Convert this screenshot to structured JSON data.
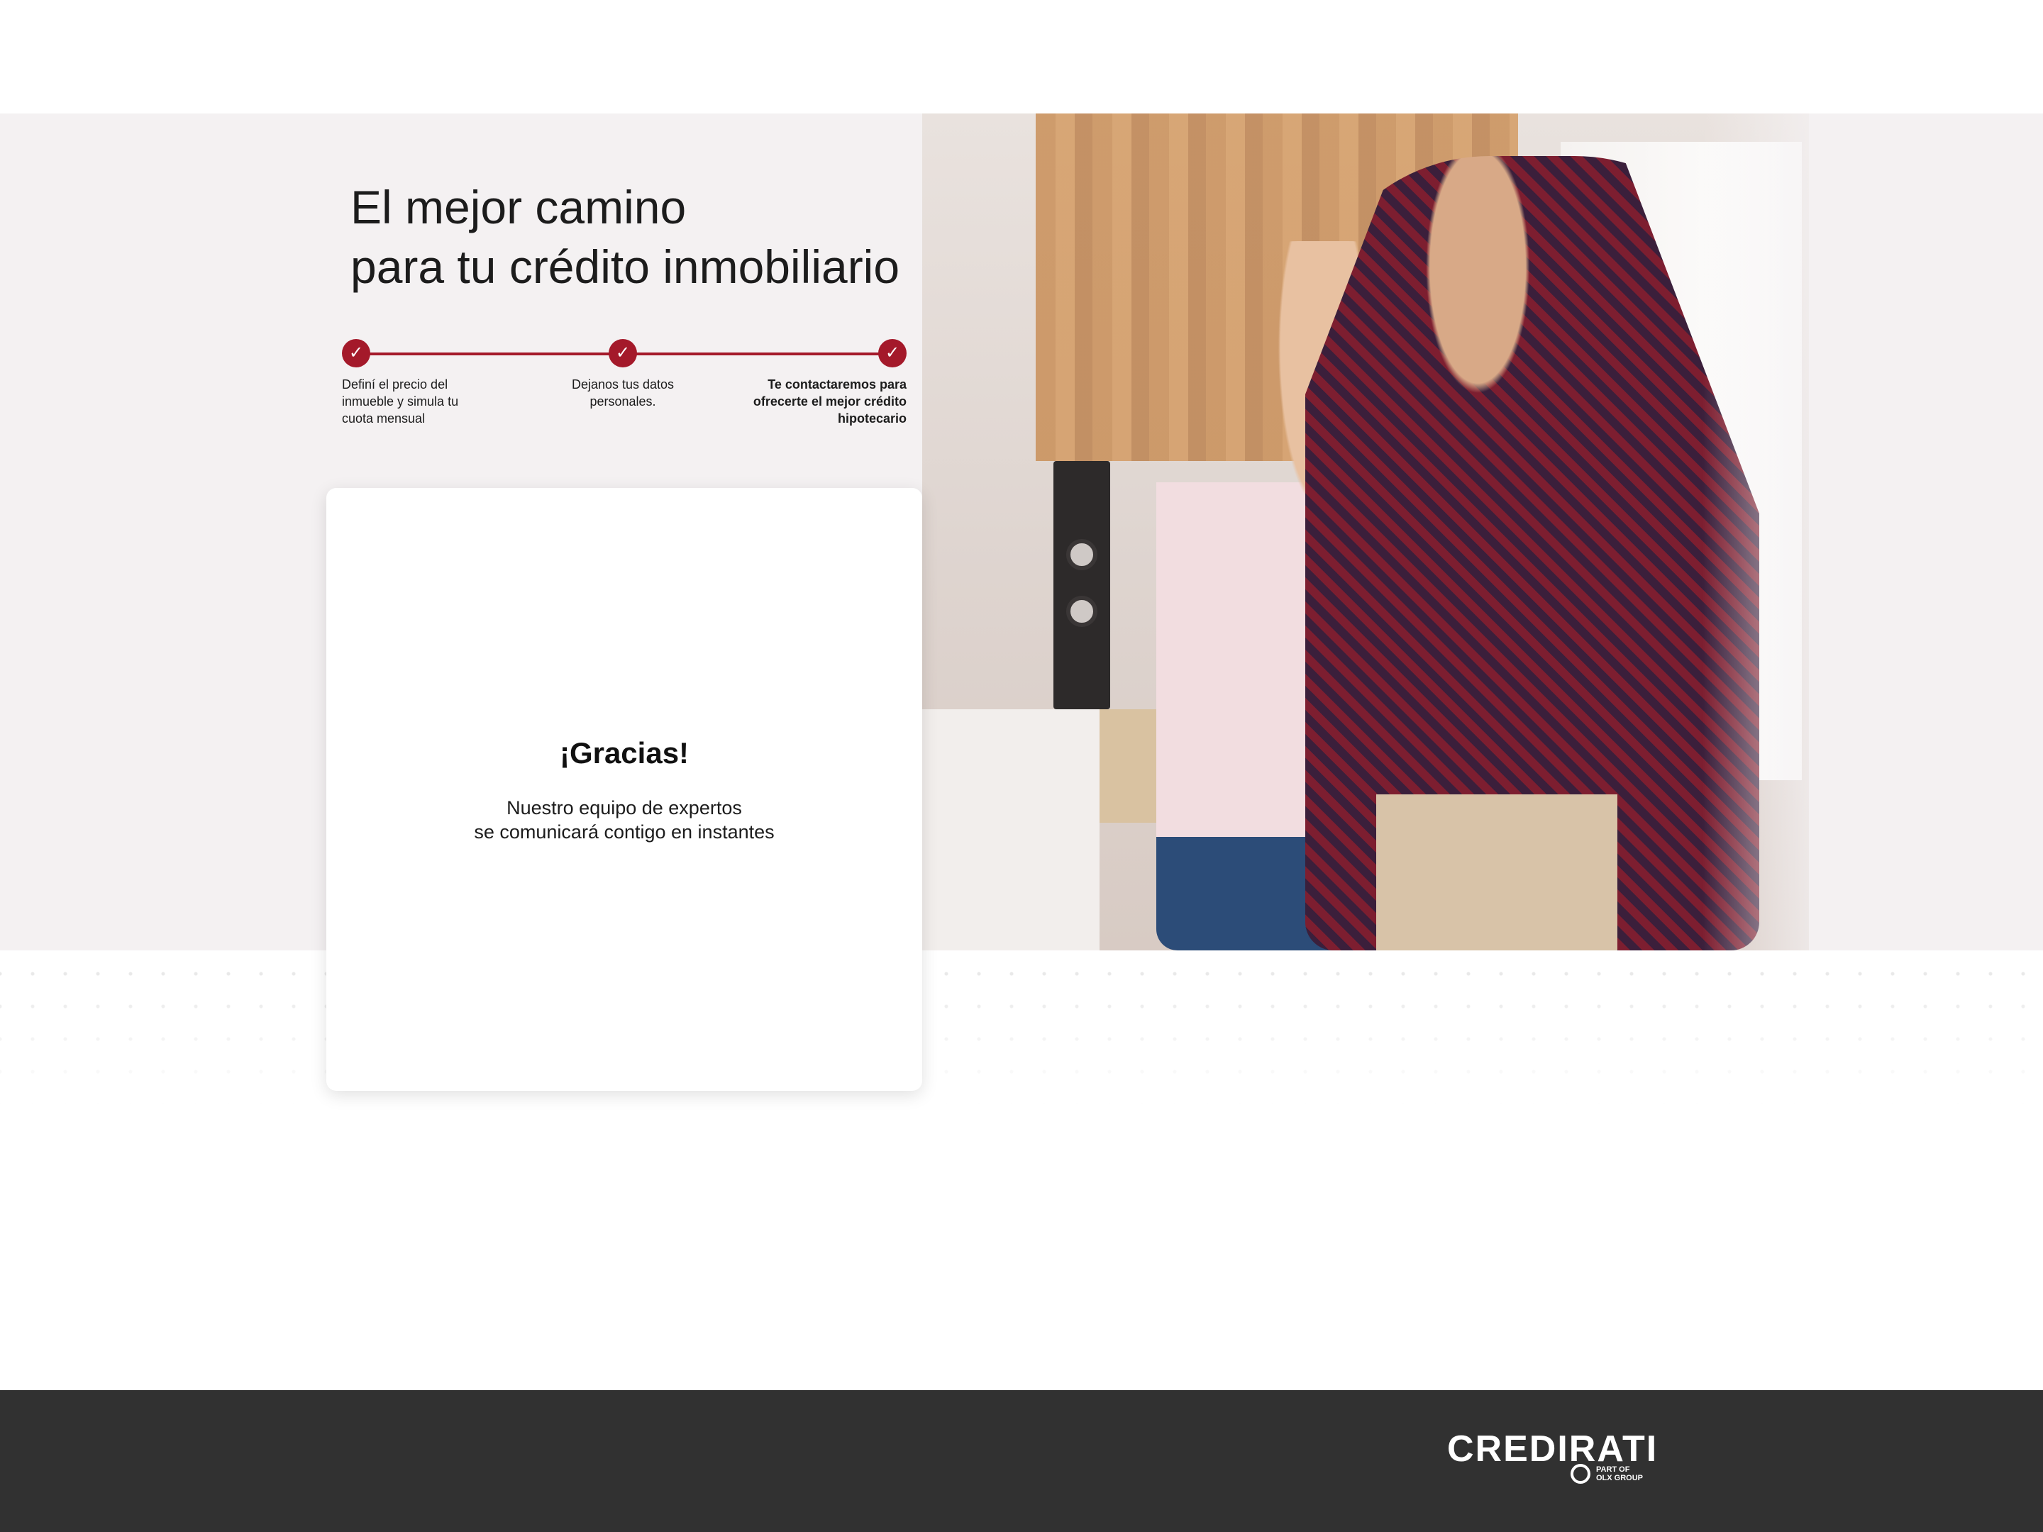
{
  "hero": {
    "headline": "El mejor camino\npara tu crédito inmobiliario",
    "photo_alt": "Pareja bailando en una sala"
  },
  "steps": [
    {
      "label": "Definí el precio del inmueble y simula tu cuota mensual",
      "status": "done"
    },
    {
      "label": "Dejanos tus datos personales.",
      "status": "done"
    },
    {
      "label": "Te contactaremos para ofrecerte el mejor crédito hipotecario",
      "status": "done"
    }
  ],
  "card": {
    "title": "¡Gracias!",
    "line1": "Nuestro equipo de expertos",
    "line2": "se comunicará contigo en instantes"
  },
  "footer": {
    "brand": "CREDIRATI",
    "brand_sub": "PART OF\nOLX GROUP"
  },
  "colors": {
    "accent": "#a4192a",
    "footer_bg": "#313131",
    "hero_bg": "#f4f1f2"
  },
  "icons": [
    "check-icon",
    "olx-group-icon"
  ]
}
